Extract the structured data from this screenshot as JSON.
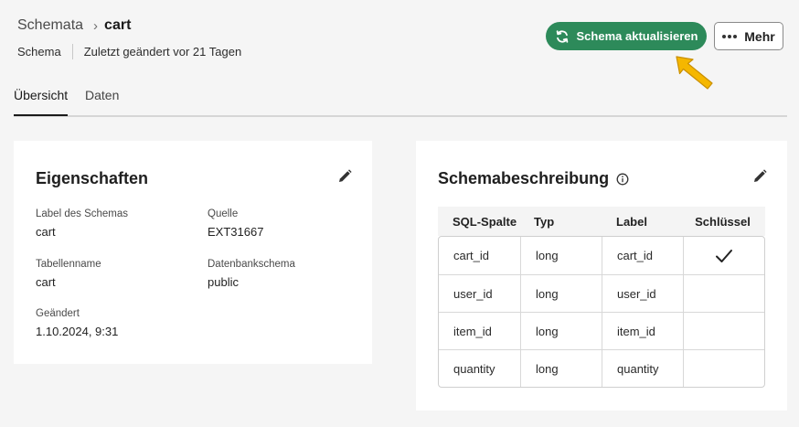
{
  "breadcrumb": {
    "parent": "Schemata",
    "separator": "›",
    "current": "cart"
  },
  "meta": {
    "type": "Schema",
    "modified": "Zuletzt geändert vor 21 Tagen"
  },
  "actions": {
    "refresh_label": "Schema aktualisieren",
    "more_label": "Mehr"
  },
  "tabs": [
    {
      "label": "Übersicht",
      "active": true
    },
    {
      "label": "Daten",
      "active": false
    }
  ],
  "properties": {
    "title": "Eigenschaften",
    "schema_label": {
      "label": "Label des Schemas",
      "value": "cart"
    },
    "source": {
      "label": "Quelle",
      "value": "EXT31667"
    },
    "table_name": {
      "label": "Tabellenname",
      "value": "cart"
    },
    "db_schema": {
      "label": "Datenbankschema",
      "value": "public"
    },
    "modified": {
      "label": "Geändert",
      "value": "1.10.2024, 9:31"
    }
  },
  "schema_description": {
    "title": "Schemabeschreibung",
    "columns": [
      "SQL-Spalte",
      "Typ",
      "Label",
      "Schlüssel"
    ],
    "rows": [
      {
        "sql": "cart_id",
        "type": "long",
        "label": "cart_id",
        "key": true
      },
      {
        "sql": "user_id",
        "type": "long",
        "label": "user_id",
        "key": false
      },
      {
        "sql": "item_id",
        "type": "long",
        "label": "item_id",
        "key": false
      },
      {
        "sql": "quantity",
        "type": "long",
        "label": "quantity",
        "key": false
      }
    ]
  },
  "colors": {
    "accent": "#2d8a5a",
    "pointer": "#f5b700"
  },
  "icons": {
    "refresh": "refresh-icon",
    "more": "more-dots-icon",
    "edit": "pencil-icon",
    "info": "info-icon",
    "check": "checkmark-icon",
    "pointer": "pointer-arrow-icon"
  }
}
